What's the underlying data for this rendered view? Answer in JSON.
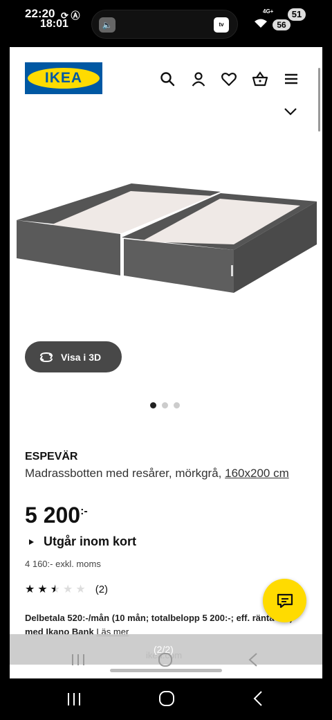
{
  "status_bar": {
    "time": "22:20",
    "time2": "18:01",
    "network": "4G+",
    "battery_main": "51",
    "battery_second": "56",
    "indicator_icons": [
      "sync-icon",
      "a-icon"
    ],
    "pill_icons": [
      "volume-icon",
      "apple-tv-icon"
    ]
  },
  "header": {
    "logo_text": "IKEA",
    "icons": [
      "search-icon",
      "account-icon",
      "heart-icon",
      "basket-icon",
      "menu-icon"
    ],
    "chevron": "chevron-down-icon"
  },
  "gallery": {
    "view_3d_label": "Visa i 3D",
    "dots": [
      true,
      false,
      false
    ]
  },
  "product": {
    "name": "ESPEVÄR",
    "description": "Madrassbotten med resårer, mörkgrå, ",
    "size_link": "160x200 cm",
    "price": "5 200",
    "price_suffix": ":-",
    "availability": "Utgår inom kort",
    "excl_vat": "4 160:- exkl. moms",
    "rating": 2.5,
    "rating_max": 5,
    "review_count": "(2)",
    "finance_text": "Delbetala 520:-/mån (10 mån; totalbelopp 5 200:-; eff. ränta 0%) med Ikano Bank ",
    "finance_link": "Läs mer"
  },
  "overlay": {
    "page_count": "(2/2)",
    "url": "ikea.com"
  },
  "colors": {
    "ikea_blue": "#0058a3",
    "ikea_yellow": "#ffdb00",
    "button_dark": "#484848"
  }
}
